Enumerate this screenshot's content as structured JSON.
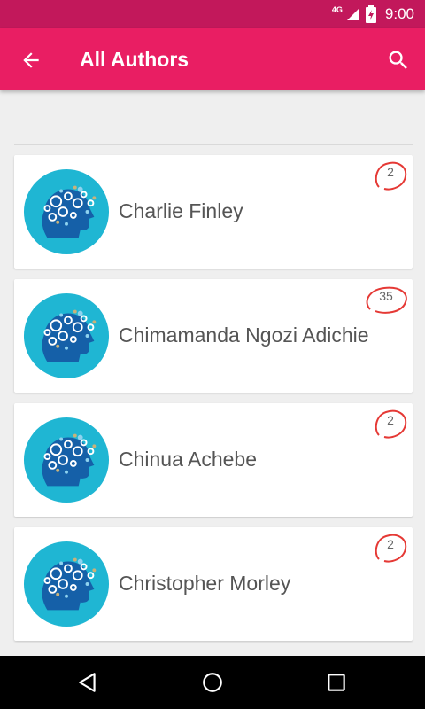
{
  "status_bar": {
    "network": "4G",
    "time": "9:00"
  },
  "app_bar": {
    "title": "All Authors",
    "back_icon": "arrow-left-icon",
    "search_icon": "search-icon"
  },
  "authors": [
    {
      "name": "Charlie Finley",
      "count": "2"
    },
    {
      "name": "Chimamanda Ngozi Adichie",
      "count": "35"
    },
    {
      "name": "Chinua Achebe",
      "count": "2"
    },
    {
      "name": "Christopher Morley",
      "count": "2"
    }
  ],
  "colors": {
    "status_bar": "#c2185b",
    "app_bar": "#e91e63",
    "badge_ring": "#e53935",
    "avatar": "#1fb6d3"
  }
}
